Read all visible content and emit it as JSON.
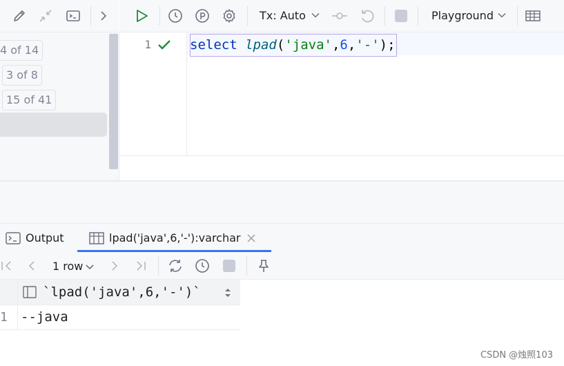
{
  "left_toolbar": {
    "icons": [
      "pencil-icon",
      "collapse-icon",
      "console-icon",
      "chevron-right-icon"
    ]
  },
  "toolbar": {
    "icons": [
      "run-icon",
      "history-icon",
      "parameters-icon",
      "settings-icon",
      "commit-icon",
      "rollback-icon",
      "stop-icon",
      "table-view-icon"
    ],
    "tx_label": "Tx: Auto",
    "schema_label": "Playground"
  },
  "navigator": {
    "badges": [
      "4 of 14",
      "3 of 8",
      "15 of 41"
    ]
  },
  "editor": {
    "line_number": "1",
    "status_icon": "check-icon",
    "code_tokens": {
      "keyword": "select",
      "function": "lpad",
      "open": "(",
      "str1": "'java'",
      "comma1": ",",
      "num": "6",
      "comma2": ",",
      "str2": "'-'",
      "close": ");"
    }
  },
  "results": {
    "tabs": [
      {
        "label": "Output",
        "icon": "console-icon"
      },
      {
        "label": "lpad('java',6,'-'):varchar",
        "icon": "table-icon",
        "active": true
      }
    ],
    "close_icon": "close-icon",
    "toolbar": {
      "row_count": "1 row",
      "icons": [
        "first-page-icon",
        "prev-page-icon",
        "next-page-icon",
        "last-page-icon",
        "refresh-icon",
        "history-icon",
        "stop-icon",
        "pin-icon"
      ]
    },
    "grid": {
      "columns": [
        "`lpad('java',6,'-')`"
      ],
      "rows": [
        {
          "num": "1",
          "values": [
            "--java"
          ]
        }
      ]
    }
  },
  "watermark": "CSDN @烛照103",
  "colors": {
    "accent": "#3574f0",
    "run_green": "#208a3c",
    "keyword": "#0033b3",
    "string": "#067d17",
    "number": "#1750eb"
  }
}
